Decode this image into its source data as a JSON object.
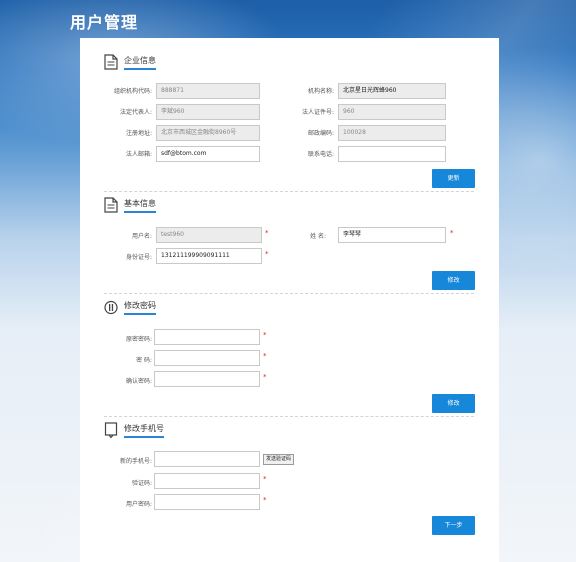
{
  "page": {
    "title": "用户管理"
  },
  "enterprise": {
    "section_title": "企业信息",
    "org_code_label": "组织机构代码:",
    "org_code_value": "888871",
    "org_name_label": "机构名称:",
    "org_name_value": "北京星日光辉蜂960",
    "legal_rep_label": "法定代表人:",
    "legal_rep_value": "李斌960",
    "legal_id_label": "法人证件号:",
    "legal_id_value": "960",
    "address_label": "注册地址:",
    "address_value": "北京市西城区金融街8960号",
    "postcode_label": "邮政编码:",
    "postcode_value": "100028",
    "email_label": "法人邮箱:",
    "email_value": "sdf@btom.com",
    "phone_label": "联系电话:",
    "phone_value": "",
    "update_button": "更新"
  },
  "basic": {
    "section_title": "基本信息",
    "username_label": "用户名:",
    "username_value": "test960",
    "name_label": "姓   名:",
    "name_value": "李琴琴",
    "id_label": "身份证号:",
    "id_value": "131211199909091111",
    "modify_button": "修改"
  },
  "password": {
    "section_title": "修改密码",
    "old_label": "原密密码:",
    "new_label": "密   码:",
    "confirm_label": "确认密码:",
    "modify_button": "修改"
  },
  "phone_change": {
    "section_title": "修改手机号",
    "new_phone_label": "新的手机号:",
    "send_code_button": "发送验证码",
    "code_label": "验证码:",
    "user_password_label": "用户密码:",
    "next_button": "下一步"
  },
  "required_mark": "*",
  "colors": {
    "accent": "#1687d9",
    "required": "#e02020"
  }
}
